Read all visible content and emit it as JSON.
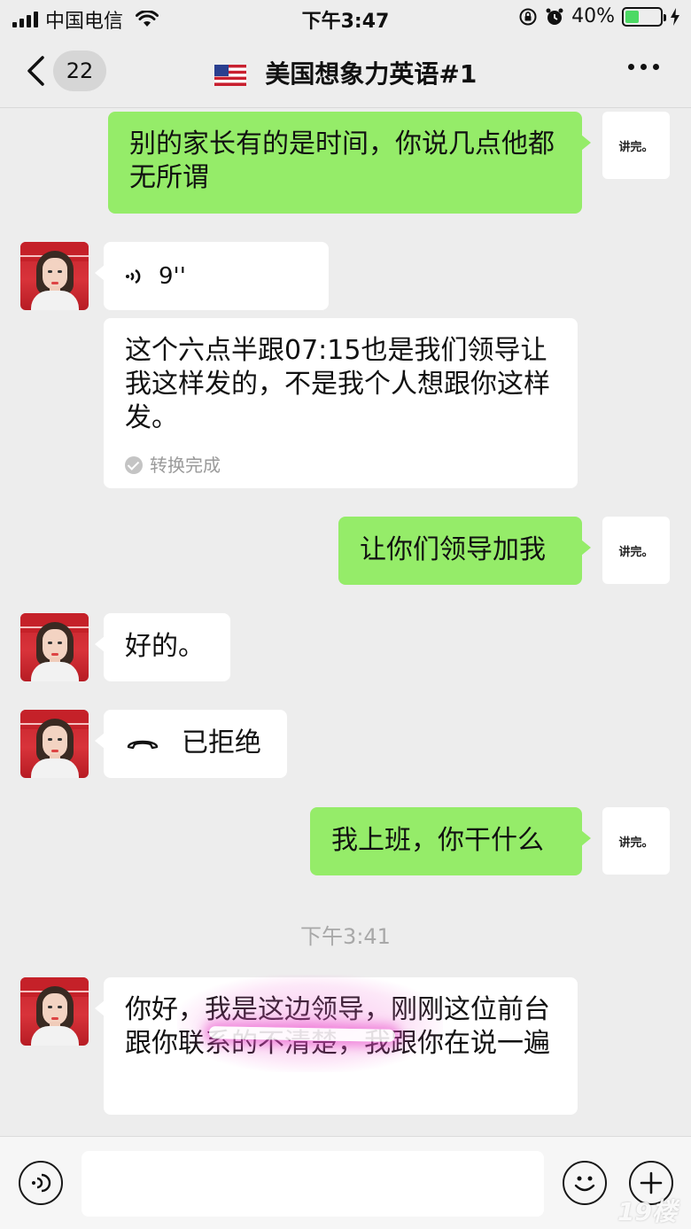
{
  "status_bar": {
    "carrier": "中国电信",
    "time": "下午3:47",
    "battery_percent_label": "40%",
    "battery_level": 0.4
  },
  "nav": {
    "unread_count": "22",
    "title": "美国想象力英语#1"
  },
  "self_avatar_text": "讲完。",
  "messages": {
    "m1": {
      "text": "别的家长有的是时间，你说几点他都无所谓"
    },
    "m2": {
      "duration": "9''"
    },
    "m3": {
      "text": "这个六点半跟07:15也是我们领导让我这样发的，不是我个人想跟你这样发。",
      "status": "转换完成"
    },
    "m4": {
      "text": "让你们领导加我"
    },
    "m5": {
      "text": "好的。"
    },
    "m6": {
      "text": "已拒绝"
    },
    "m7": {
      "text": "我上班，你干什么"
    },
    "m8": {
      "text": "你好，我是这边领导，刚刚这位前台跟你联系的不清楚，我跟你在说一遍"
    }
  },
  "timestamp": "下午3:41",
  "watermark": "19楼",
  "colors": {
    "sent_bubble": "#95ec69",
    "received_bubble": "#ffffff",
    "background": "#ededed",
    "highlight": "#e846c8"
  }
}
